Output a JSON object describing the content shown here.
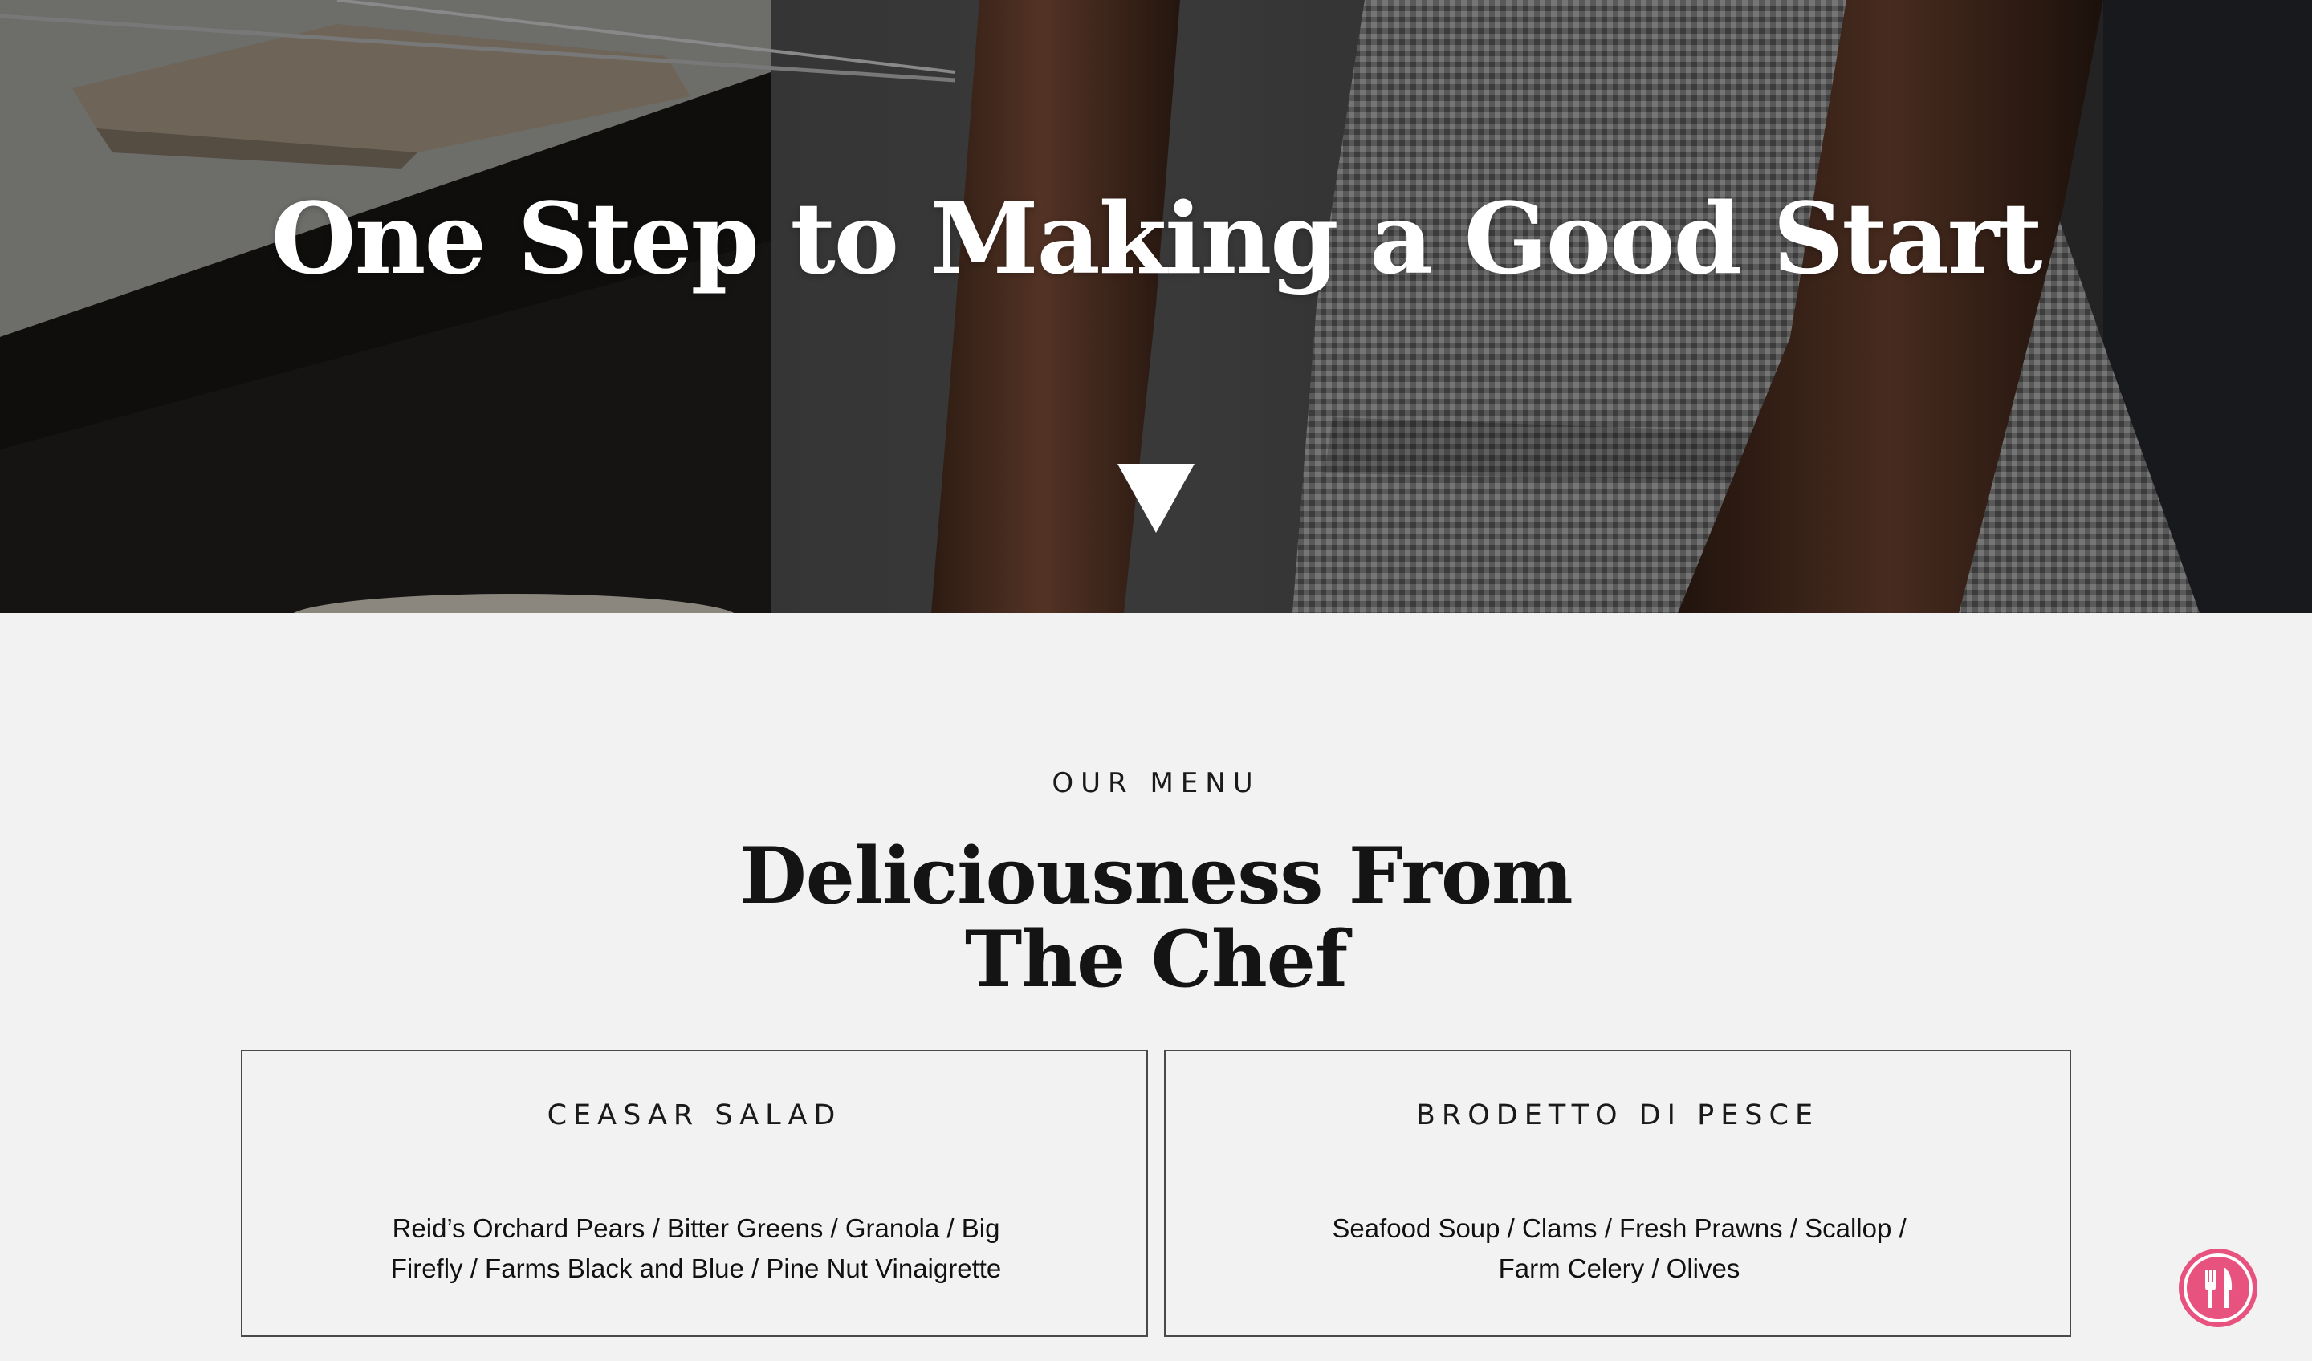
{
  "hero": {
    "title": "One Step to Making a Good Start",
    "scroll_icon": "triangle-down-icon"
  },
  "menu": {
    "eyebrow": "OUR MENU",
    "title": "Deliciousness From The Chef",
    "items": [
      {
        "name": "CEASAR SALAD",
        "description": "Reid’s Orchard Pears / Bitter Greens / Granola / Big Firefly / Farms Black and Blue / Pine Nut Vinaigrette"
      },
      {
        "name": "BRODETTO DI PESCE",
        "description": "Seafood Soup / Clams / Fresh Prawns / Scallop / Farm Celery / Olives"
      }
    ]
  },
  "floating_button": {
    "icon": "fork-knife-icon",
    "color": "#e8527f"
  }
}
